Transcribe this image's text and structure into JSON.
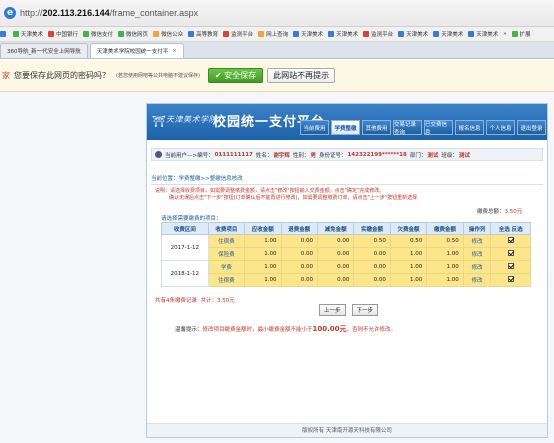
{
  "browser": {
    "url_prefix": "http://",
    "url_host": "202.113.216.144",
    "url_path": "/frame_container.aspx",
    "favorites": [
      "",
      "天津美术",
      "中国银行",
      "微信支付",
      "微信网页",
      "微信公众",
      "高等教育",
      "监测平台",
      "网上查询",
      "天津美术",
      "天津美术",
      "监测平台",
      "天津美术",
      "天津美术",
      "天津美术",
      "»",
      "扩展"
    ],
    "tabs": [
      {
        "label": "360导航_新一代安全上网导航"
      },
      {
        "label": "天津美术学院校园统一支付平"
      }
    ],
    "password_prompt": {
      "question": "您要保存此网页的密码吗？",
      "note": "(若您使用网吧等公共电脑不建议保存)",
      "save_label": "安全保存",
      "never_label": "此网站不再提示"
    }
  },
  "header": {
    "school": "天津美术学院",
    "title": "校园统一支付平台",
    "nav": [
      "当前费用",
      "学费整缴",
      "其他费用",
      "交易记录查询",
      "已交费信息",
      "报名信息",
      "个人信息",
      "退出登录"
    ],
    "active_nav": "学费整缴"
  },
  "userbar": {
    "prefix": "当前用户—>编号：",
    "id": "0111111117",
    "name_label": "姓名：",
    "name": "谢宇辉",
    "gender_label": "性别：",
    "gender": "男",
    "idcard_label": "身份证号：",
    "idcard": "142322199******18",
    "dept_label": "部门：",
    "dept": "测试",
    "class_label": "班级：",
    "class": "测试"
  },
  "breadcrumb": "当前位置：学费整缴>>整缴信息核改",
  "notice": {
    "line1": "说明：请选择收费项目，如需要调整缴费金额，请点击\"修改\"按钮输入交费金额，点击\"确定\"完成修改。",
    "line2": "确认无误后点击\"下一步\"按钮(订单确认后不能再进行修改)，如需要调整缴费订单，请点击\"上一步\"按钮重新选择"
  },
  "total_top": {
    "label": "缴费总额：",
    "value": "3.50元"
  },
  "select_label": "请选择需要缴费的项目：",
  "table": {
    "headers": [
      "收费区间",
      "收费项目",
      "应收金额",
      "退费金额",
      "减免金额",
      "实缴金额",
      "欠费金额",
      "缴费金额",
      "操作列",
      "全选 反选"
    ],
    "groups": [
      {
        "term": "2017-1-12",
        "rows": [
          {
            "item": "住宿费",
            "due": "1.00",
            "refund": "0.00",
            "waive": "0.00",
            "paid": "0.50",
            "owe": "0.50",
            "pay": "0.50",
            "op": "修改"
          },
          {
            "item": "保险费",
            "due": "1.00",
            "refund": "0.00",
            "waive": "0.00",
            "paid": "0.00",
            "owe": "1.00",
            "pay": "1.00",
            "op": "修改"
          }
        ]
      },
      {
        "term": "2018-1-12",
        "rows": [
          {
            "item": "学费",
            "due": "1.00",
            "refund": "0.00",
            "waive": "0.00",
            "paid": "0.00",
            "owe": "1.00",
            "pay": "1.00",
            "op": "修改"
          },
          {
            "item": "住宿费",
            "due": "1.00",
            "refund": "0.00",
            "waive": "0.00",
            "paid": "0.00",
            "owe": "1.00",
            "pay": "1.00",
            "op": "修改"
          }
        ]
      }
    ]
  },
  "summary": {
    "text": "共有4条缴费记录",
    "total_label": "共计：",
    "total": "3.50元"
  },
  "buttons": {
    "prev": "上一步",
    "next": "下一步"
  },
  "tip": {
    "label": "温馨提示：",
    "text": "修改项目缴费金额时，最小缴费金额不能小于",
    "min": "100.00元",
    "tail": "，否则不允许修改。"
  },
  "footer": "版权所有 天津南开源天科技有限公司",
  "colors": {
    "accent": "#1d62a8",
    "row_highlight": "#fde58a",
    "warning": "#c0392b"
  }
}
